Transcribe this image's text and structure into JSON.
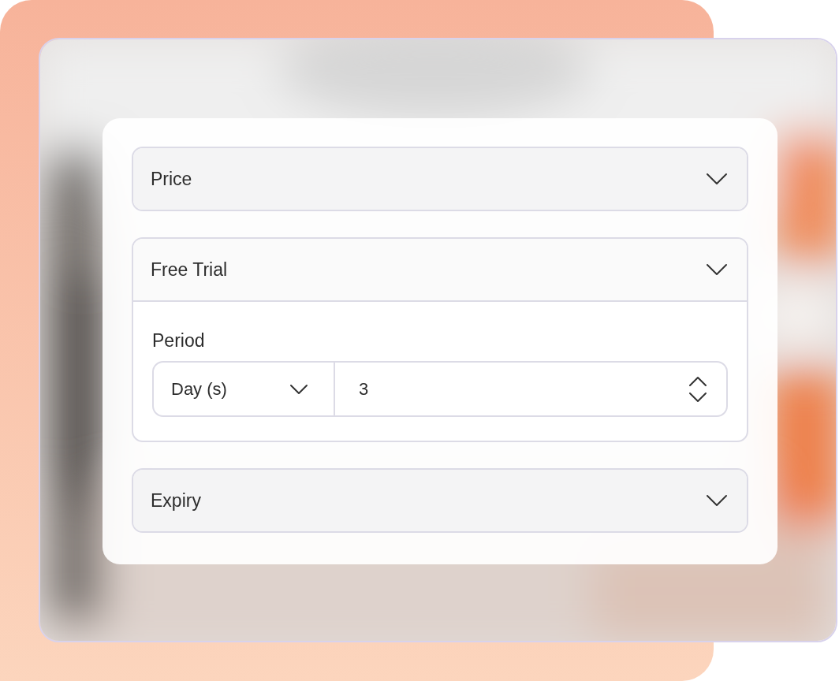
{
  "sections": [
    {
      "title": "Price",
      "expanded": false
    },
    {
      "title": "Free Trial",
      "expanded": true,
      "period": {
        "label": "Period",
        "unit": "Day (s)",
        "value": "3"
      }
    },
    {
      "title": "Expiry",
      "expanded": false
    }
  ]
}
